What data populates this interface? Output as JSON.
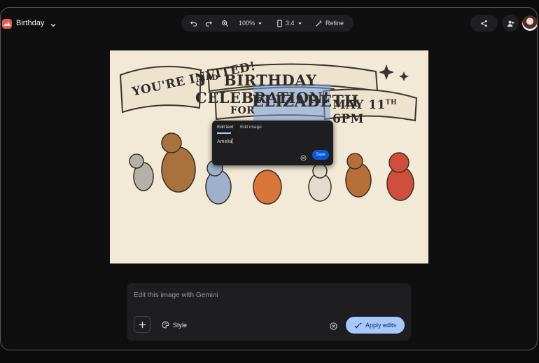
{
  "header": {
    "title": "Birthday",
    "zoom": "100%",
    "aspect_ratio": "3:4",
    "refine_label": "Refine"
  },
  "image": {
    "invite_line": "YOU'RE INVITED!",
    "headline_ordinal": "3",
    "headline_suffix": "RD",
    "headline_rest": "BIRTHDAY CELEBRATION!",
    "for_word": "FOR",
    "name": "ELIZABETH",
    "date_prefix": "MAY 11",
    "date_suffix": "TH",
    "time": "6PM"
  },
  "edit_popover": {
    "tabs": [
      "Edit text",
      "Edit image"
    ],
    "input_value": "Amelia",
    "save_label": "Save"
  },
  "composer": {
    "placeholder": "Edit this image with Gemini",
    "style_label": "Style",
    "apply_label": "Apply edits"
  },
  "colors": {
    "accent": "#a8c7fa",
    "save_button": "#0b57d0",
    "app_logo": "#e8594f",
    "canvas_paper": "#f2e9d6"
  },
  "icons": [
    "app-logo-icon",
    "chevron-down-icon",
    "undo-icon",
    "redo-icon",
    "zoom-icon",
    "aspect-icon",
    "sparkle-wand-icon",
    "share-icon",
    "add-person-icon",
    "plus-icon",
    "palette-icon",
    "clear-icon",
    "check-sparkle-icon"
  ]
}
